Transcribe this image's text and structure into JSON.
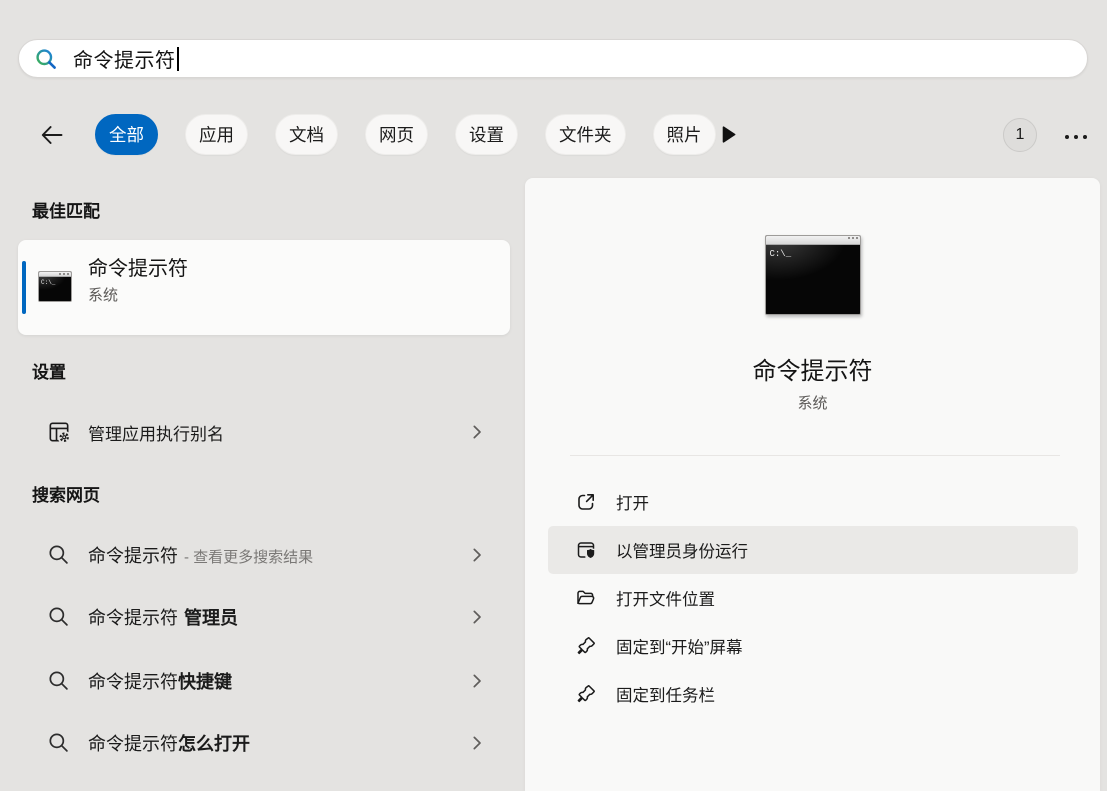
{
  "colors": {
    "background": "#e4e3e1",
    "accent_blue": "#0067c0",
    "panel_bg": "#f9f9f8",
    "highlight_row": "#eae9e7"
  },
  "search": {
    "value": "命令提示符"
  },
  "toolbar": {
    "tabs": [
      {
        "label": "全部",
        "active": true
      },
      {
        "label": "应用"
      },
      {
        "label": "文档"
      },
      {
        "label": "网页"
      },
      {
        "label": "设置"
      },
      {
        "label": "文件夹"
      },
      {
        "label": "照片"
      }
    ],
    "badge": "1"
  },
  "left_panel": {
    "best_match": {
      "header": "最佳匹配",
      "item": {
        "title": "命令提示符",
        "subtitle": "系统"
      }
    },
    "settings": {
      "header": "设置",
      "items": [
        {
          "label": "管理应用执行别名"
        }
      ]
    },
    "web_search": {
      "header": "搜索网页",
      "items": [
        {
          "text": "命令提示符",
          "suffix": "- 查看更多搜索结果"
        },
        {
          "text": "命令提示符",
          "bold": "管理员"
        },
        {
          "text": "命令提示符",
          "bold": "快捷键"
        },
        {
          "text": "命令提示符",
          "bold": "怎么打开"
        }
      ]
    }
  },
  "preview_panel": {
    "app_title": "命令提示符",
    "app_subtitle": "系统",
    "icon_prompt_text": "C:\\_",
    "actions": [
      {
        "label": "打开"
      },
      {
        "label": "以管理员身份运行",
        "highlighted": true
      },
      {
        "label": "打开文件位置"
      },
      {
        "label": "固定到“开始”屏幕"
      },
      {
        "label": "固定到任务栏"
      }
    ]
  }
}
